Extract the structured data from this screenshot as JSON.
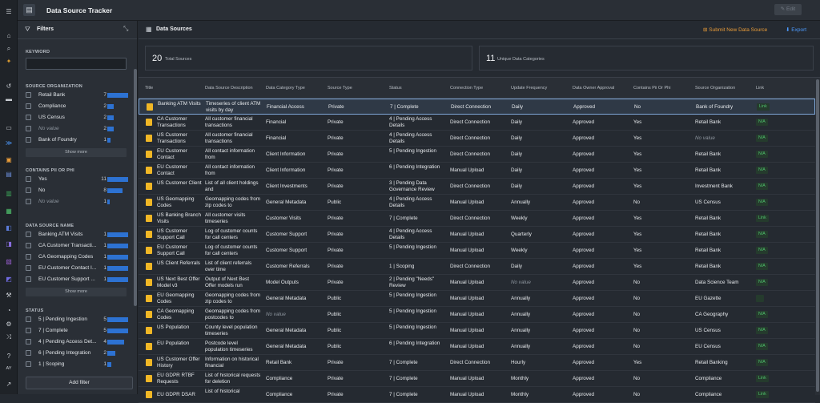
{
  "app": {
    "title": "Data Source Tracker",
    "edit_label": "Edit"
  },
  "filters": {
    "title": "Filters",
    "keyword_label": "KEYWORD",
    "add_filter_label": "Add filter",
    "show_more_label": "Show more",
    "source_org": {
      "label": "SOURCE ORGANIZATION",
      "items": [
        {
          "label": "Retail Bank",
          "count": "7",
          "frac": 1.0
        },
        {
          "label": "Compliance",
          "count": "2",
          "frac": 0.29
        },
        {
          "label": "US Census",
          "count": "2",
          "frac": 0.29
        },
        {
          "label": "No value",
          "count": "2",
          "frac": 0.29,
          "empty": true
        },
        {
          "label": "Bank of Foundry",
          "count": "1",
          "frac": 0.14
        }
      ]
    },
    "pii": {
      "label": "CONTAINS PII OR PHI",
      "items": [
        {
          "label": "Yes",
          "count": "11",
          "frac": 1.0
        },
        {
          "label": "No",
          "count": "8",
          "frac": 0.73
        },
        {
          "label": "No value",
          "count": "1",
          "frac": 0.09,
          "empty": true
        }
      ]
    },
    "ds_name": {
      "label": "DATA SOURCE NAME",
      "items": [
        {
          "label": "Banking ATM Visits",
          "count": "1",
          "frac": 1.0
        },
        {
          "label": "CA Customer Transacti...",
          "count": "1",
          "frac": 1.0
        },
        {
          "label": "CA Geomapping Codes",
          "count": "1",
          "frac": 1.0
        },
        {
          "label": "EU Customer Contact I...",
          "count": "1",
          "frac": 1.0
        },
        {
          "label": "EU Customer Support ...",
          "count": "1",
          "frac": 1.0
        }
      ]
    },
    "status": {
      "label": "STATUS",
      "items": [
        {
          "label": "5 | Pending Ingestion",
          "count": "5",
          "frac": 1.0
        },
        {
          "label": "7 | Complete",
          "count": "5",
          "frac": 1.0
        },
        {
          "label": "4 | Pending Access Det...",
          "count": "4",
          "frac": 0.8
        },
        {
          "label": "6 | Pending Integration",
          "count": "2",
          "frac": 0.4
        },
        {
          "label": "1 | Scoping",
          "count": "1",
          "frac": 0.2
        }
      ]
    }
  },
  "main": {
    "title": "Data Sources",
    "submit_label": "Submit New Data Source",
    "export_label": "Export",
    "stats": {
      "total_value": "20",
      "total_label": "Total Sources",
      "cats_value": "11",
      "cats_label": "Unique Data Categories"
    },
    "columns": [
      "Title",
      "Data Source Description",
      "Data Category Type",
      "Source Type",
      "Status",
      "Connection Type",
      "Update Frequency",
      "Data Owner Approval",
      "Contains Pii Or Phi",
      "Source Organization",
      "Link"
    ],
    "rows": [
      [
        "Banking ATM Visits",
        "Timeseries of client ATM visits by day",
        "Financial Access",
        "Private",
        "7 | Complete",
        "Direct Connection",
        "Daily",
        "Approved",
        "No",
        "Bank of Foundry",
        "Link"
      ],
      [
        "CA Customer Transactions",
        "All customer financial transactions",
        "Financial",
        "Private",
        "4 | Pending Access Details",
        "Direct Connection",
        "Daily",
        "Approved",
        "Yes",
        "Retail Bank",
        "N/A"
      ],
      [
        "US Customer Transactions",
        "All customer financial transactions",
        "Financial",
        "Private",
        "4 | Pending Access Details",
        "Direct Connection",
        "Daily",
        "Approved",
        "Yes",
        "No value",
        "N/A"
      ],
      [
        "EU Customer Contact",
        "All contact information from",
        "Client Information",
        "Private",
        "5 | Pending Ingestion",
        "Direct Connection",
        "Daily",
        "Approved",
        "Yes",
        "Retail Bank",
        "N/A"
      ],
      [
        "EU Customer Contact",
        "All contact information from",
        "Client Information",
        "Private",
        "6 | Pending Integration",
        "Manual Upload",
        "Daily",
        "Approved",
        "Yes",
        "Retail Bank",
        "N/A"
      ],
      [
        "US Customer Client",
        "List of all client holdings and",
        "Client Investments",
        "Private",
        "3 | Pending Data Governance Review",
        "Direct Connection",
        "Daily",
        "Approved",
        "Yes",
        "Investment Bank",
        "N/A"
      ],
      [
        "US Geomapping Codes",
        "Geomapping codes from zip codes to",
        "General Metadata",
        "Public",
        "4 | Pending Access Details",
        "Manual Upload",
        "Annually",
        "Approved",
        "No",
        "US Census",
        "N/A"
      ],
      [
        "US Banking Branch Visits",
        "All customer visits timeseries",
        "Customer Visits",
        "Private",
        "7 | Complete",
        "Direct Connection",
        "Weekly",
        "Approved",
        "Yes",
        "Retail Bank",
        "Link"
      ],
      [
        "US Customer Support Call",
        "Log of customer counts for call centers",
        "Customer Support",
        "Private",
        "4 | Pending Access Details",
        "Manual Upload",
        "Quarterly",
        "Approved",
        "Yes",
        "Retail Bank",
        "N/A"
      ],
      [
        "EU Customer Support Call",
        "Log of customer counts for call centers",
        "Customer Support",
        "Private",
        "5 | Pending Ingestion",
        "Manual Upload",
        "Weekly",
        "Approved",
        "Yes",
        "Retail Bank",
        "N/A"
      ],
      [
        "US Client Referrals",
        "List of client referrals over time",
        "Customer Referrals",
        "Private",
        "1 | Scoping",
        "Direct Connection",
        "Daily",
        "Approved",
        "Yes",
        "Retail Bank",
        "N/A"
      ],
      [
        "US Next Best Offer Model v3",
        "Output of Next Best Offer models run",
        "Model Outputs",
        "Private",
        "2 | Pending \"Needs\" Review",
        "Manual Upload",
        "No value",
        "Approved",
        "No",
        "Data Science Team",
        "N/A"
      ],
      [
        "EU Geomapping Codes",
        "Geomapping codes from zip codes to",
        "General Metadata",
        "Public",
        "5 | Pending Ingestion",
        "Manual Upload",
        "Annually",
        "Approved",
        "No",
        "EU Gazette",
        ""
      ],
      [
        "CA Geomapping Codes",
        "Geomapping codes from postcodes to",
        "No value",
        "Public",
        "5 | Pending Ingestion",
        "Manual Upload",
        "Annually",
        "Approved",
        "No",
        "CA Geography",
        "N/A"
      ],
      [
        "US Population",
        "County level population timeseries",
        "General Metadata",
        "Public",
        "5 | Pending Ingestion",
        "Manual Upload",
        "Annually",
        "Approved",
        "No",
        "US Census",
        "N/A"
      ],
      [
        "EU Population",
        "Postcode level population timeseries",
        "General Metadata",
        "Public",
        "6 | Pending Integration",
        "Manual Upload",
        "Annually",
        "Approved",
        "No",
        "EU Census",
        "N/A"
      ],
      [
        "US Customer Offer History",
        "Information on historical financial",
        "Retail Bank",
        "Private",
        "7 | Complete",
        "Direct Connection",
        "Hourly",
        "Approved",
        "Yes",
        "Retail Banking",
        "N/A"
      ],
      [
        "EU GDPR RTBF Requests",
        "List of historical requests for deletion",
        "Compliance",
        "Private",
        "7 | Complete",
        "Manual Upload",
        "Monthly",
        "Approved",
        "No",
        "Compliance",
        "Link"
      ],
      [
        "EU GDPR DSAR",
        "List of historical",
        "Compliance",
        "Private",
        "7 | Complete",
        "Manual Upload",
        "Monthly",
        "Approved",
        "No",
        "Compliance",
        "Link"
      ]
    ]
  },
  "colors": {
    "accent_blue": "#2d72d2",
    "link_green": "#4fc36d",
    "submit_orange": "#e79b39",
    "title_icon": "#f0b726"
  }
}
